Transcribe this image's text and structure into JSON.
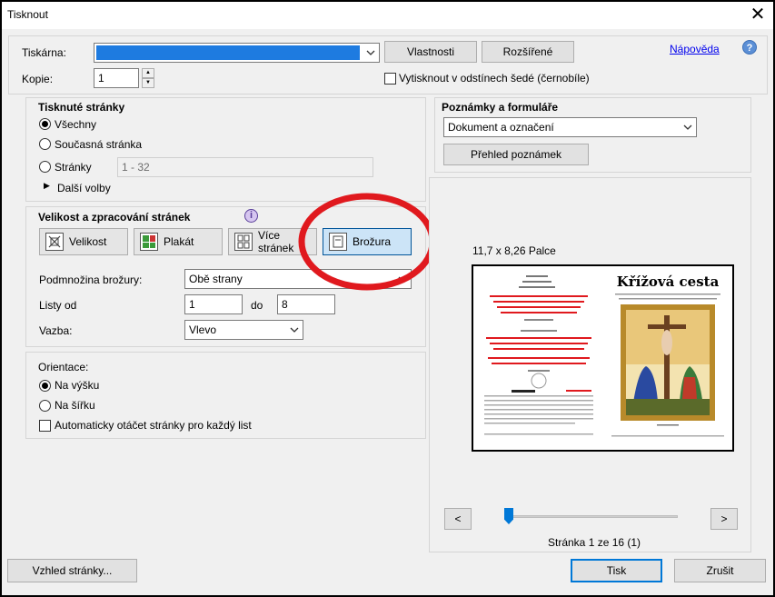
{
  "window": {
    "title": "Tisknout",
    "close_glyph": "✕"
  },
  "printer": {
    "label": "Tiskárna:",
    "value": "",
    "properties_label": "Vlastnosti",
    "advanced_label": "Rozšířené",
    "help_link": "Nápověda",
    "help_glyph": "?"
  },
  "copies": {
    "label": "Kopie:",
    "value": "1",
    "grayscale_label": "Vytisknout v odstínech šedé (černobíle)"
  },
  "pages": {
    "heading": "Tisknuté stránky",
    "all_label": "Všechny",
    "current_label": "Současná stránka",
    "range_label": "Stránky",
    "range_value": "1 - 32",
    "more_label": "Další volby"
  },
  "sizing": {
    "heading": "Velikost a zpracování stránek",
    "info_glyph": "i",
    "buttons": [
      {
        "label": "Velikost",
        "icon": "fit-size-icon"
      },
      {
        "label": "Plakát",
        "icon": "poster-icon"
      },
      {
        "label": "Více stránek",
        "icon": "multiple-pages-icon"
      },
      {
        "label": "Brožura",
        "icon": "booklet-icon"
      }
    ],
    "subset_label": "Podmnožina brožury:",
    "subset_value": "Obě strany",
    "sheets_label": "Listy od",
    "sheets_from": "1",
    "sheets_to_label": "do",
    "sheets_to": "8",
    "binding_label": "Vazba:",
    "binding_value": "Vlevo"
  },
  "orientation": {
    "heading": "Orientace:",
    "portrait_label": "Na výšku",
    "landscape_label": "Na šířku",
    "auto_rotate_label": "Automaticky otáčet stránky pro každý list"
  },
  "comments": {
    "heading": "Poznámky a formuláře",
    "value": "Dokument a označení",
    "summary_label": "Přehled poznámek"
  },
  "preview": {
    "size_label": "11,7 x 8,26 Palce",
    "right_title": "Křížová cesta",
    "page_status": "Stránka 1 ze 16 (1)",
    "prev_glyph": "<",
    "next_glyph": ">",
    "slider_position": 0
  },
  "footer": {
    "page_setup_label": "Vzhled stránky...",
    "print_label": "Tisk",
    "cancel_label": "Zrušit"
  },
  "colors": {
    "accent": "#0078d7",
    "annotation": "#e0191e"
  }
}
